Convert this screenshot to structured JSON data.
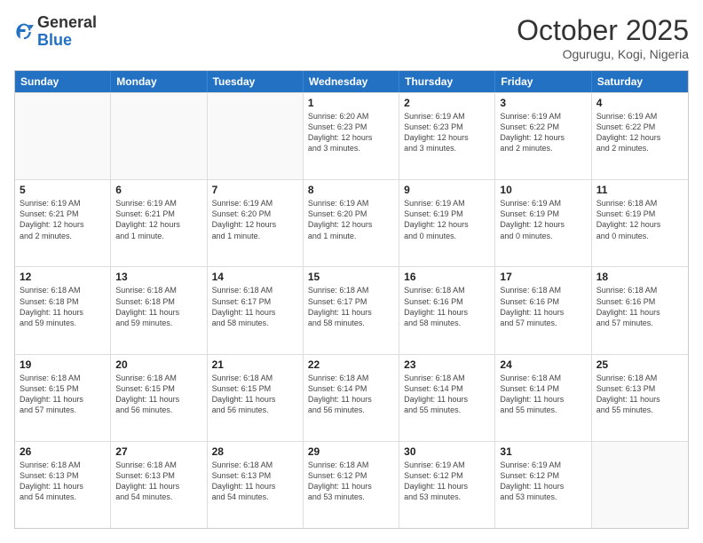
{
  "logo": {
    "general": "General",
    "blue": "Blue"
  },
  "header": {
    "month": "October 2025",
    "location": "Ogurugu, Kogi, Nigeria"
  },
  "weekdays": [
    "Sunday",
    "Monday",
    "Tuesday",
    "Wednesday",
    "Thursday",
    "Friday",
    "Saturday"
  ],
  "rows": [
    [
      {
        "day": "",
        "lines": []
      },
      {
        "day": "",
        "lines": []
      },
      {
        "day": "",
        "lines": []
      },
      {
        "day": "1",
        "lines": [
          "Sunrise: 6:20 AM",
          "Sunset: 6:23 PM",
          "Daylight: 12 hours",
          "and 3 minutes."
        ]
      },
      {
        "day": "2",
        "lines": [
          "Sunrise: 6:19 AM",
          "Sunset: 6:23 PM",
          "Daylight: 12 hours",
          "and 3 minutes."
        ]
      },
      {
        "day": "3",
        "lines": [
          "Sunrise: 6:19 AM",
          "Sunset: 6:22 PM",
          "Daylight: 12 hours",
          "and 2 minutes."
        ]
      },
      {
        "day": "4",
        "lines": [
          "Sunrise: 6:19 AM",
          "Sunset: 6:22 PM",
          "Daylight: 12 hours",
          "and 2 minutes."
        ]
      }
    ],
    [
      {
        "day": "5",
        "lines": [
          "Sunrise: 6:19 AM",
          "Sunset: 6:21 PM",
          "Daylight: 12 hours",
          "and 2 minutes."
        ]
      },
      {
        "day": "6",
        "lines": [
          "Sunrise: 6:19 AM",
          "Sunset: 6:21 PM",
          "Daylight: 12 hours",
          "and 1 minute."
        ]
      },
      {
        "day": "7",
        "lines": [
          "Sunrise: 6:19 AM",
          "Sunset: 6:20 PM",
          "Daylight: 12 hours",
          "and 1 minute."
        ]
      },
      {
        "day": "8",
        "lines": [
          "Sunrise: 6:19 AM",
          "Sunset: 6:20 PM",
          "Daylight: 12 hours",
          "and 1 minute."
        ]
      },
      {
        "day": "9",
        "lines": [
          "Sunrise: 6:19 AM",
          "Sunset: 6:19 PM",
          "Daylight: 12 hours",
          "and 0 minutes."
        ]
      },
      {
        "day": "10",
        "lines": [
          "Sunrise: 6:19 AM",
          "Sunset: 6:19 PM",
          "Daylight: 12 hours",
          "and 0 minutes."
        ]
      },
      {
        "day": "11",
        "lines": [
          "Sunrise: 6:18 AM",
          "Sunset: 6:19 PM",
          "Daylight: 12 hours",
          "and 0 minutes."
        ]
      }
    ],
    [
      {
        "day": "12",
        "lines": [
          "Sunrise: 6:18 AM",
          "Sunset: 6:18 PM",
          "Daylight: 11 hours",
          "and 59 minutes."
        ]
      },
      {
        "day": "13",
        "lines": [
          "Sunrise: 6:18 AM",
          "Sunset: 6:18 PM",
          "Daylight: 11 hours",
          "and 59 minutes."
        ]
      },
      {
        "day": "14",
        "lines": [
          "Sunrise: 6:18 AM",
          "Sunset: 6:17 PM",
          "Daylight: 11 hours",
          "and 58 minutes."
        ]
      },
      {
        "day": "15",
        "lines": [
          "Sunrise: 6:18 AM",
          "Sunset: 6:17 PM",
          "Daylight: 11 hours",
          "and 58 minutes."
        ]
      },
      {
        "day": "16",
        "lines": [
          "Sunrise: 6:18 AM",
          "Sunset: 6:16 PM",
          "Daylight: 11 hours",
          "and 58 minutes."
        ]
      },
      {
        "day": "17",
        "lines": [
          "Sunrise: 6:18 AM",
          "Sunset: 6:16 PM",
          "Daylight: 11 hours",
          "and 57 minutes."
        ]
      },
      {
        "day": "18",
        "lines": [
          "Sunrise: 6:18 AM",
          "Sunset: 6:16 PM",
          "Daylight: 11 hours",
          "and 57 minutes."
        ]
      }
    ],
    [
      {
        "day": "19",
        "lines": [
          "Sunrise: 6:18 AM",
          "Sunset: 6:15 PM",
          "Daylight: 11 hours",
          "and 57 minutes."
        ]
      },
      {
        "day": "20",
        "lines": [
          "Sunrise: 6:18 AM",
          "Sunset: 6:15 PM",
          "Daylight: 11 hours",
          "and 56 minutes."
        ]
      },
      {
        "day": "21",
        "lines": [
          "Sunrise: 6:18 AM",
          "Sunset: 6:15 PM",
          "Daylight: 11 hours",
          "and 56 minutes."
        ]
      },
      {
        "day": "22",
        "lines": [
          "Sunrise: 6:18 AM",
          "Sunset: 6:14 PM",
          "Daylight: 11 hours",
          "and 56 minutes."
        ]
      },
      {
        "day": "23",
        "lines": [
          "Sunrise: 6:18 AM",
          "Sunset: 6:14 PM",
          "Daylight: 11 hours",
          "and 55 minutes."
        ]
      },
      {
        "day": "24",
        "lines": [
          "Sunrise: 6:18 AM",
          "Sunset: 6:14 PM",
          "Daylight: 11 hours",
          "and 55 minutes."
        ]
      },
      {
        "day": "25",
        "lines": [
          "Sunrise: 6:18 AM",
          "Sunset: 6:13 PM",
          "Daylight: 11 hours",
          "and 55 minutes."
        ]
      }
    ],
    [
      {
        "day": "26",
        "lines": [
          "Sunrise: 6:18 AM",
          "Sunset: 6:13 PM",
          "Daylight: 11 hours",
          "and 54 minutes."
        ]
      },
      {
        "day": "27",
        "lines": [
          "Sunrise: 6:18 AM",
          "Sunset: 6:13 PM",
          "Daylight: 11 hours",
          "and 54 minutes."
        ]
      },
      {
        "day": "28",
        "lines": [
          "Sunrise: 6:18 AM",
          "Sunset: 6:13 PM",
          "Daylight: 11 hours",
          "and 54 minutes."
        ]
      },
      {
        "day": "29",
        "lines": [
          "Sunrise: 6:18 AM",
          "Sunset: 6:12 PM",
          "Daylight: 11 hours",
          "and 53 minutes."
        ]
      },
      {
        "day": "30",
        "lines": [
          "Sunrise: 6:19 AM",
          "Sunset: 6:12 PM",
          "Daylight: 11 hours",
          "and 53 minutes."
        ]
      },
      {
        "day": "31",
        "lines": [
          "Sunrise: 6:19 AM",
          "Sunset: 6:12 PM",
          "Daylight: 11 hours",
          "and 53 minutes."
        ]
      },
      {
        "day": "",
        "lines": []
      }
    ]
  ]
}
